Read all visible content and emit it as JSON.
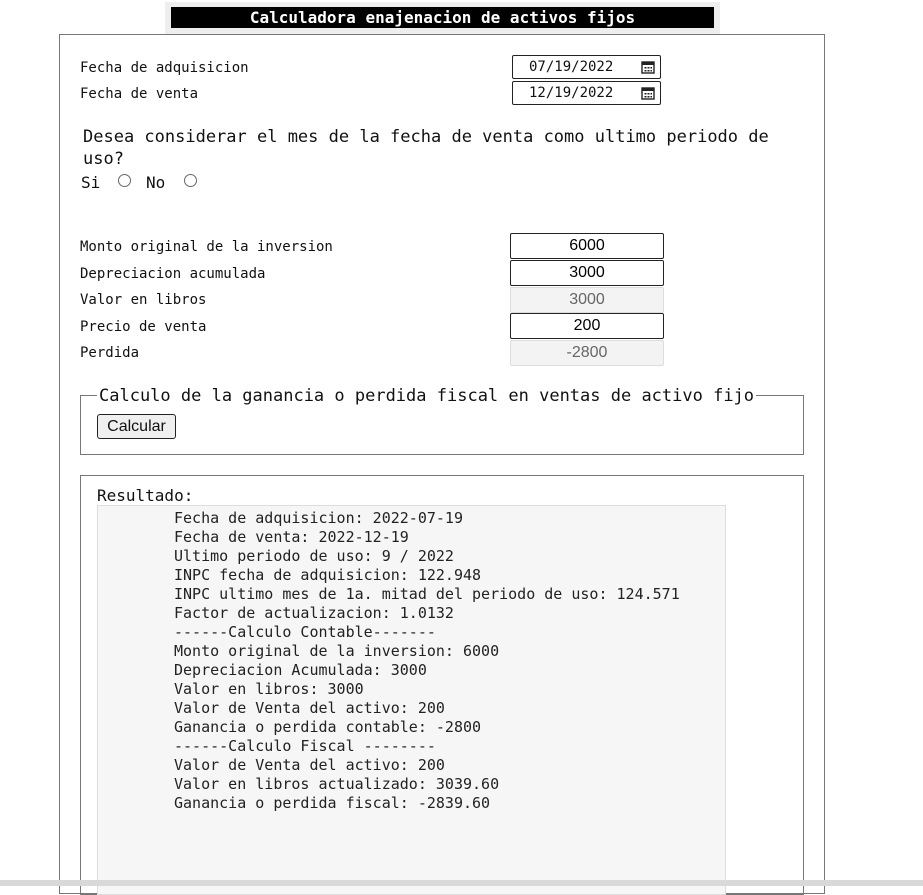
{
  "app_title": "Calculadora enajenacion de activos fijos",
  "dates": {
    "adquisicion_label": "Fecha de adquisicion",
    "adquisicion_value": "07/19/2022",
    "venta_label": "Fecha de venta",
    "venta_value": "12/19/2022",
    "icon": "calendar-icon"
  },
  "question": {
    "text": "Desea considerar el mes de la fecha de venta como ultimo periodo de uso?",
    "option_si": "Si",
    "option_no": "No"
  },
  "fields": {
    "monto_label": "Monto original de la inversion",
    "monto_value": "6000",
    "depreciacion_label": "Depreciacion acumulada",
    "depreciacion_value": "3000",
    "valor_libros_label": "Valor en libros",
    "valor_libros_value": "3000",
    "precio_venta_label": "Precio de venta",
    "precio_venta_value": "200",
    "perdida_label": "Perdida",
    "perdida_value": "-2800"
  },
  "calc": {
    "legend": "Calculo de la ganancia o perdida fiscal en ventas de activo fijo",
    "button": "Calcular"
  },
  "result": {
    "label": "Resultado:",
    "lines": [
      "Fecha de adquisicion: 2022-07-19",
      "Fecha de venta: 2022-12-19",
      "Ultimo periodo de uso: 9 / 2022",
      "INPC fecha de adquisicion: 122.948",
      "INPC ultimo mes de 1a. mitad del periodo de uso: 124.571",
      "Factor de actualizacion: 1.0132",
      "------Calculo Contable-------",
      "Monto original de la inversion: 6000",
      "Depreciacion Acumulada: 3000",
      "Valor en libros: 3000",
      "Valor de Venta del activo: 200",
      "Ganancia o perdida contable: -2800",
      "------Calculo Fiscal --------",
      "Valor de Venta del activo: 200",
      "Valor en libros actualizado: 3039.60",
      "Ganancia o perdida fiscal: -2839.60"
    ]
  }
}
